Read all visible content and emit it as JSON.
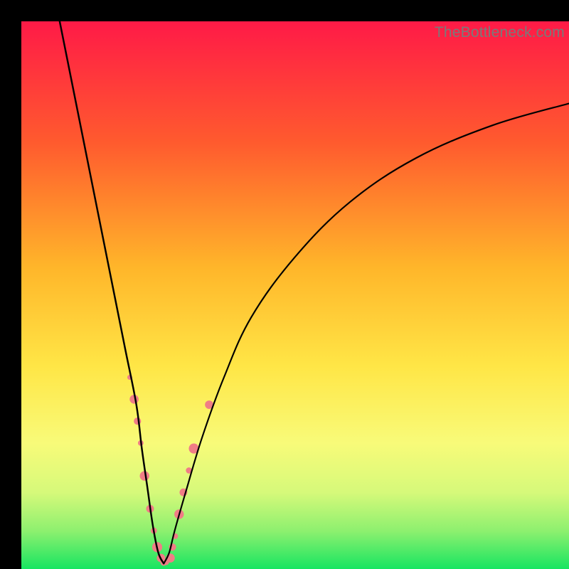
{
  "watermark": "TheBottleneck.com",
  "chart_data": {
    "type": "line",
    "title": "",
    "xlabel": "",
    "ylabel": "",
    "xlim": [
      0,
      100
    ],
    "ylim": [
      0,
      100
    ],
    "grid": false,
    "legend": false,
    "note": "Bottleneck V-curve with rainbow gradient background (red top → green bottom). Axes are unlabeled; values are relative percentages estimated from the rendered shape. Pink markers highlight the lower region of both branches.",
    "gradient_stops": [
      {
        "offset": 0,
        "color": "#ff1a47"
      },
      {
        "offset": 22,
        "color": "#ff5a2e"
      },
      {
        "offset": 45,
        "color": "#ffb62a"
      },
      {
        "offset": 63,
        "color": "#ffe646"
      },
      {
        "offset": 77,
        "color": "#f8fb79"
      },
      {
        "offset": 86,
        "color": "#d6f97a"
      },
      {
        "offset": 93,
        "color": "#8ef06f"
      },
      {
        "offset": 100,
        "color": "#17e561"
      }
    ],
    "series": [
      {
        "name": "left-branch",
        "x": [
          7,
          9,
          11,
          13,
          15,
          17,
          19,
          21,
          22,
          23,
          24,
          25,
          26
        ],
        "y": [
          100,
          90,
          80,
          70,
          60,
          50,
          40,
          30,
          22,
          15,
          8,
          3,
          1
        ]
      },
      {
        "name": "right-branch",
        "x": [
          26,
          27,
          28,
          30,
          33,
          37,
          42,
          50,
          60,
          72,
          86,
          100
        ],
        "y": [
          1,
          3,
          7,
          14,
          24,
          35,
          46,
          57,
          67,
          75,
          81,
          85
        ]
      }
    ],
    "markers": {
      "color": "#f07d86",
      "radius_range": [
        3.5,
        7.5
      ],
      "points": [
        {
          "x": 19.8,
          "y": 35
        },
        {
          "x": 20.6,
          "y": 31
        },
        {
          "x": 21.2,
          "y": 27
        },
        {
          "x": 21.8,
          "y": 23
        },
        {
          "x": 22.5,
          "y": 17
        },
        {
          "x": 23.5,
          "y": 11
        },
        {
          "x": 24.2,
          "y": 7
        },
        {
          "x": 24.8,
          "y": 4
        },
        {
          "x": 25.5,
          "y": 2
        },
        {
          "x": 26.0,
          "y": 1.2
        },
        {
          "x": 26.5,
          "y": 1.2
        },
        {
          "x": 27.2,
          "y": 2
        },
        {
          "x": 27.6,
          "y": 4
        },
        {
          "x": 28.1,
          "y": 6
        },
        {
          "x": 28.8,
          "y": 10
        },
        {
          "x": 29.6,
          "y": 14
        },
        {
          "x": 30.6,
          "y": 18
        },
        {
          "x": 31.5,
          "y": 22
        },
        {
          "x": 34.3,
          "y": 30
        }
      ]
    }
  }
}
